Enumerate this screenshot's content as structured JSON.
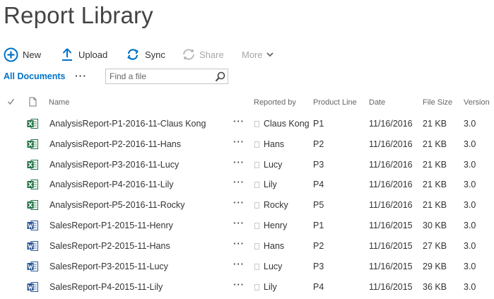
{
  "page": {
    "title": "Report Library"
  },
  "toolbar": {
    "new_label": "New",
    "upload_label": "Upload",
    "sync_label": "Sync",
    "share_label": "Share",
    "more_label": "More"
  },
  "view": {
    "current": "All Documents",
    "search_placeholder": "Find a file"
  },
  "columns": {
    "name": "Name",
    "reported_by": "Reported by",
    "product_line": "Product Line",
    "date": "Date",
    "file_size": "File Size",
    "version": "Version"
  },
  "colors": {
    "accent": "#0072c6",
    "excel": "#207245",
    "word": "#2b579a"
  },
  "files": [
    {
      "icon": "excel-file-icon",
      "name": "AnalysisReport-P1-2016-11-Claus Kong",
      "reported_by": "Claus Kong",
      "product_line": "P1",
      "date": "11/16/2016",
      "size": "21 KB",
      "version": "3.0"
    },
    {
      "icon": "excel-file-icon",
      "name": "AnalysisReport-P2-2016-11-Hans",
      "reported_by": "Hans",
      "product_line": "P2",
      "date": "11/16/2016",
      "size": "21 KB",
      "version": "3.0"
    },
    {
      "icon": "excel-file-icon",
      "name": "AnalysisReport-P3-2016-11-Lucy",
      "reported_by": "Lucy",
      "product_line": "P3",
      "date": "11/16/2016",
      "size": "21 KB",
      "version": "3.0"
    },
    {
      "icon": "excel-file-icon",
      "name": "AnalysisReport-P4-2016-11-Lily",
      "reported_by": "Lily",
      "product_line": "P4",
      "date": "11/16/2016",
      "size": "21 KB",
      "version": "3.0"
    },
    {
      "icon": "excel-file-icon",
      "name": "AnalysisReport-P5-2016-11-Rocky",
      "reported_by": "Rocky",
      "product_line": "P5",
      "date": "11/16/2016",
      "size": "21 KB",
      "version": "3.0"
    },
    {
      "icon": "word-file-icon",
      "name": "SalesReport-P1-2015-11-Henry",
      "reported_by": "Henry",
      "product_line": "P1",
      "date": "11/16/2015",
      "size": "30 KB",
      "version": "3.0"
    },
    {
      "icon": "word-file-icon",
      "name": "SalesReport-P2-2015-11-Hans",
      "reported_by": "Hans",
      "product_line": "P2",
      "date": "11/16/2015",
      "size": "27 KB",
      "version": "3.0"
    },
    {
      "icon": "word-file-icon",
      "name": "SalesReport-P3-2015-11-Lucy",
      "reported_by": "Lucy",
      "product_line": "P3",
      "date": "11/16/2015",
      "size": "29 KB",
      "version": "3.0"
    },
    {
      "icon": "word-file-icon",
      "name": "SalesReport-P4-2015-11-Lily",
      "reported_by": "Lily",
      "product_line": "P4",
      "date": "11/16/2015",
      "size": "36 KB",
      "version": "3.0"
    }
  ]
}
